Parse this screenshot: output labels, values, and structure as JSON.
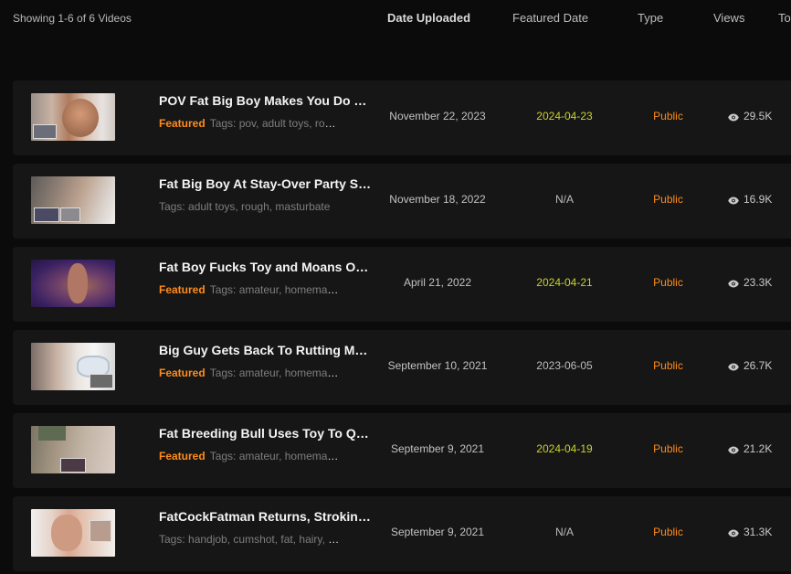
{
  "header": {
    "count": "Showing 1-6 of 6 Videos",
    "columns": {
      "date_uploaded": "Date Uploaded",
      "featured_date": "Featured Date",
      "type": "Type",
      "views": "Views",
      "to": "To"
    }
  },
  "featured_label": "Featured",
  "videos": [
    {
      "title": "POV Fat Big Boy Makes You Do Ora...",
      "featured": true,
      "tags": "Tags: pov, adult toys, roug...",
      "uploaded": "November 22, 2023",
      "featured_date": "2024-04-23",
      "type": "Public",
      "views": "29.5K"
    },
    {
      "title": "Fat Big Boy At Stay-Over Party Stro...",
      "featured": false,
      "tags": "Tags: adult toys, rough, masturbate",
      "uploaded": "November 18, 2022",
      "featured_date": "N/A",
      "type": "Public",
      "views": "16.9K"
    },
    {
      "title": "Fat Boy Fucks Toy and Moans Out ...",
      "featured": true,
      "tags": "Tags: amateur, homemad...",
      "uploaded": "April 21, 2022",
      "featured_date": "2024-04-21",
      "type": "Public",
      "views": "23.3K"
    },
    {
      "title": "Big Guy Gets Back To Rutting Moun...",
      "featured": true,
      "tags": "Tags: amateur, homemad...",
      "uploaded": "September 10, 2021",
      "featured_date": "2023-06-05",
      "type": "Public",
      "views": "26.7K"
    },
    {
      "title": "Fat Breeding Bull Uses Toy To Quen...",
      "featured": true,
      "tags": "Tags: amateur, homemad...",
      "uploaded": "September 9, 2021",
      "featured_date": "2024-04-19",
      "type": "Public",
      "views": "21.2K"
    },
    {
      "title": "FatCockFatman Returns, Stroking ...",
      "featured": false,
      "tags": "Tags: handjob, cumshot, fat, hairy, b...",
      "uploaded": "September 9, 2021",
      "featured_date": "N/A",
      "type": "Public",
      "views": "31.3K"
    }
  ]
}
